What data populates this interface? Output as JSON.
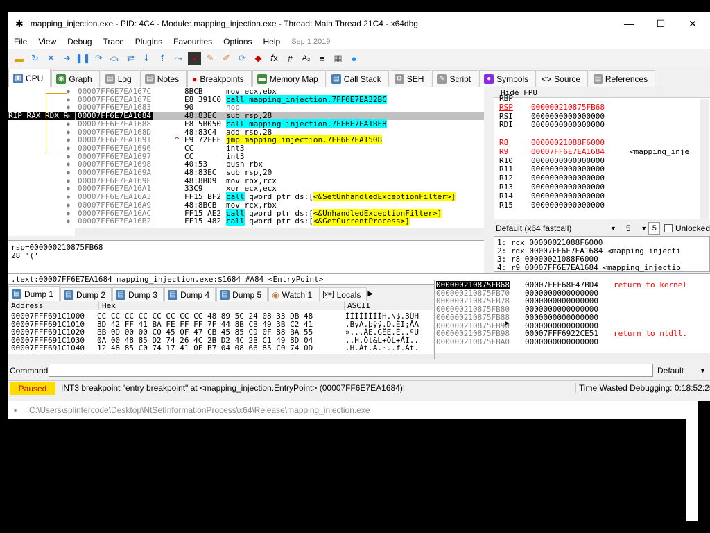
{
  "window": {
    "title": "mapping_injection.exe - PID: 4C4 - Module: mapping_injection.exe - Thread: Main Thread 21C4 - x64dbg",
    "minimize": "—",
    "maximize": "☐",
    "close": "✕"
  },
  "menu": {
    "items": [
      "File",
      "View",
      "Debug",
      "Trace",
      "Plugins",
      "Favourites",
      "Options",
      "Help"
    ],
    "date": "Sep 1 2019"
  },
  "tabs": [
    {
      "label": "CPU",
      "icon": "cpu-icon",
      "color": "#4a7fb5"
    },
    {
      "label": "Graph",
      "icon": "graph-icon",
      "color": "#3c8c3c"
    },
    {
      "label": "Log",
      "icon": "log-icon",
      "color": "#777777"
    },
    {
      "label": "Notes",
      "icon": "notes-icon",
      "color": "#777777"
    },
    {
      "label": "Breakpoints",
      "icon": "breakpoint-icon",
      "color": "#cc0000"
    },
    {
      "label": "Memory Map",
      "icon": "memory-icon",
      "color": "#3c8c3c"
    },
    {
      "label": "Call Stack",
      "icon": "callstack-icon",
      "color": "#4a7fb5"
    },
    {
      "label": "SEH",
      "icon": "seh-icon",
      "color": "#777777"
    },
    {
      "label": "Script",
      "icon": "script-icon",
      "color": "#777777"
    },
    {
      "label": "Symbols",
      "icon": "symbols-icon",
      "color": "#8a2be2"
    },
    {
      "label": "Source",
      "icon": "source-icon",
      "color": "#555555"
    },
    {
      "label": "References",
      "icon": "references-icon",
      "color": "#777777"
    }
  ],
  "disasm": {
    "rip_label": "RIP RAX RDX R",
    "rows": [
      {
        "addr": "00007FF6E7EA167C",
        "bytes": "8BCB",
        "ins": "mov ecx,ebx",
        "kind": "plain"
      },
      {
        "addr": "00007FF6E7EA167E",
        "bytes": "E8 391C0",
        "ins": "call mapping_injection.7FF6E7EA32BC",
        "kind": "call"
      },
      {
        "addr": "00007FF6E7EA1683",
        "bytes": "90",
        "ins": "nop",
        "kind": "nop"
      },
      {
        "addr": "00007FF6E7EA1684",
        "bytes": "48:83EC",
        "ins": "sub rsp,28",
        "kind": "plain",
        "selected": true
      },
      {
        "addr": "00007FF6E7EA1688",
        "bytes": "E8 5B050",
        "ins": "call mapping_injection.7FF6E7EA1BE8",
        "kind": "call"
      },
      {
        "addr": "00007FF6E7EA168D",
        "bytes": "48:83C4",
        "ins": "add rsp,28",
        "kind": "plain"
      },
      {
        "addr": "00007FF6E7EA1691",
        "bytes": "E9 72FEF",
        "ins": "jmp mapping_injection.7FF6E7EA1508",
        "kind": "jmp",
        "arrow": "^"
      },
      {
        "addr": "00007FF6E7EA1696",
        "bytes": "CC",
        "ins": "int3",
        "kind": "plain"
      },
      {
        "addr": "00007FF6E7EA1697",
        "bytes": "CC",
        "ins": "int3",
        "kind": "plain"
      },
      {
        "addr": "00007FF6E7EA1698",
        "bytes": "40:53",
        "ins": "push rbx",
        "kind": "plain"
      },
      {
        "addr": "00007FF6E7EA169A",
        "bytes": "48:83EC",
        "ins": "sub rsp,20",
        "kind": "plain"
      },
      {
        "addr": "00007FF6E7EA169E",
        "bytes": "48:8BD9",
        "ins": "mov rbx,rcx",
        "kind": "plain"
      },
      {
        "addr": "00007FF6E7EA16A1",
        "bytes": "33C9",
        "ins": "xor ecx,ecx",
        "kind": "plain"
      },
      {
        "addr": "00007FF6E7EA16A3",
        "bytes": "FF15 BF2",
        "ins_call": "call",
        "ins_rest": " qword ptr ds:[",
        "ins_target": "<&SetUnhandledExceptionFilter>]",
        "kind": "callptr"
      },
      {
        "addr": "00007FF6E7EA16A9",
        "bytes": "48:8BCB",
        "ins": "mov rcx,rbx",
        "kind": "plain"
      },
      {
        "addr": "00007FF6E7EA16AC",
        "bytes": "FF15 AE2",
        "ins_call": "call",
        "ins_rest": " qword ptr ds:[",
        "ins_target": "<&UnhandledExceptionFilter>]",
        "kind": "callptr"
      },
      {
        "addr": "00007FF6E7EA16B2",
        "bytes": "FF15 482",
        "ins_call": "call",
        "ins_rest": " qword ptr ds:[",
        "ins_target": "<&GetCurrentProcess>]",
        "kind": "callptr"
      }
    ]
  },
  "registers": {
    "header_hide": "Hide FPU",
    "rows": [
      {
        "name": "RBP",
        "value": "",
        "red": false
      },
      {
        "name": "RSP",
        "value": "000000210875FB68",
        "red": true
      },
      {
        "name": "RSI",
        "value": "0000000000000000",
        "red": false
      },
      {
        "name": "RDI",
        "value": "0000000000000000",
        "red": false
      },
      {
        "name": "",
        "value": "",
        "red": false
      },
      {
        "name": "R8",
        "value": "00000021088F6000",
        "red": true
      },
      {
        "name": "R9",
        "value": "00007FF6E7EA1684",
        "red": true,
        "note": "<mapping_inje"
      },
      {
        "name": "R10",
        "value": "0000000000000000",
        "red": false
      },
      {
        "name": "R11",
        "value": "0000000000000000",
        "red": false
      },
      {
        "name": "R12",
        "value": "0000000000000000",
        "red": false
      },
      {
        "name": "R13",
        "value": "0000000000000000",
        "red": false
      },
      {
        "name": "R14",
        "value": "0000000000000000",
        "red": false
      },
      {
        "name": "R15",
        "value": "0000000000000000",
        "red": false
      }
    ]
  },
  "callconv": {
    "selected": "Default (x64 fastcall)",
    "count": "5",
    "spin_value": "5",
    "unlocked": "Unlocked"
  },
  "args": [
    "1: rcx 00000021088F6000",
    "2: rdx 00007FF6E7EA1684 <mapping_injecti",
    "3: r8 00000021088F6000",
    "4: r9 00007FF6E7EA1684 <mapping_injectio"
  ],
  "info": {
    "line1": "rsp=000000210875FB68",
    "line2": "28 '('"
  },
  "location": ".text:00007FF6E7EA1684 mapping_injection.exe:$1684 #A84 <EntryPoint>",
  "dump_tabs": [
    "Dump 1",
    "Dump 2",
    "Dump 3",
    "Dump 4",
    "Dump 5",
    "Watch 1",
    "Locals"
  ],
  "dump": {
    "col_address": "Address",
    "col_hex": "Hex",
    "col_ascii": "ASCII",
    "rows": [
      {
        "addr": "00007FFF691C1000",
        "hex": "CC CC CC CC CC CC CC CC 48 89 5C 24 08 33 DB 48",
        "ascii": "ÌÌÌÌÌÌÌÌH.\\$.3ÛH"
      },
      {
        "addr": "00007FFF691C1010",
        "hex": "8D 42 FF 41 BA FE FF FF 7F 44 8B CB 49 3B C2 41",
        "ascii": ".ByA.þÿÿ.D.ËI;ÂA"
      },
      {
        "addr": "00007FFF691C1020",
        "hex": "BB 0D 00 00 C0 45 0F 47 CB 45 85 C9 0F 88 BA 55",
        "ascii": "»...ÀE.GËE.É..ºU"
      },
      {
        "addr": "00007FFF691C1030",
        "hex": "0A 00 48 85 D2 74 26 4C 2B D2 4C 2B C1 49 8D 04",
        "ascii": "..H.Òt&L+ÒL+ÁI.."
      },
      {
        "addr": "00007FFF691C1040",
        "hex": "12 48 85 C0 74 17 41 0F B7 04 08 66 85 C0 74 0D",
        "ascii": ".H.Àt.A.·..f.Àt."
      }
    ]
  },
  "stack": {
    "rows": [
      {
        "addr": "000000210875FB68",
        "val": "00007FFF68F47BD4",
        "comment": "return to kernel",
        "selected": true
      },
      {
        "addr": "000000210875FB70",
        "val": "0000000000000000",
        "comment": ""
      },
      {
        "addr": "000000210875FB78",
        "val": "0000000000000000",
        "comment": ""
      },
      {
        "addr": "000000210875FB80",
        "val": "0000000000000000",
        "comment": ""
      },
      {
        "addr": "000000210875FB88",
        "val": "0000000000000000",
        "comment": ""
      },
      {
        "addr": "000000210875FB90",
        "val": "0000000000000000",
        "comment": ""
      },
      {
        "addr": "000000210875FB98",
        "val": "00007FFF6922CE51",
        "comment": "return to ntdll."
      },
      {
        "addr": "000000210875FBA0",
        "val": "0000000000000000",
        "comment": ""
      }
    ]
  },
  "command": {
    "label": "Command:",
    "value": "",
    "mode": "Default"
  },
  "status": {
    "paused": "Paused",
    "message": "INT3 breakpoint \"entry breakpoint\" at <mapping_injection.EntryPoint> (00007FF6E7EA1684)!",
    "time": "Time Wasted Debugging: 0:18:52:25"
  },
  "console": {
    "title": "C:\\Users\\splintercode\\Desktop\\NtSetInformationProcess\\x64\\Release\\mapping_injection.exe"
  },
  "colors": {
    "paused_bg": "#ffdc00",
    "call_hl": "#00ffff",
    "jmp_hl": "#ffff00",
    "changed_reg": "#ff0000"
  }
}
